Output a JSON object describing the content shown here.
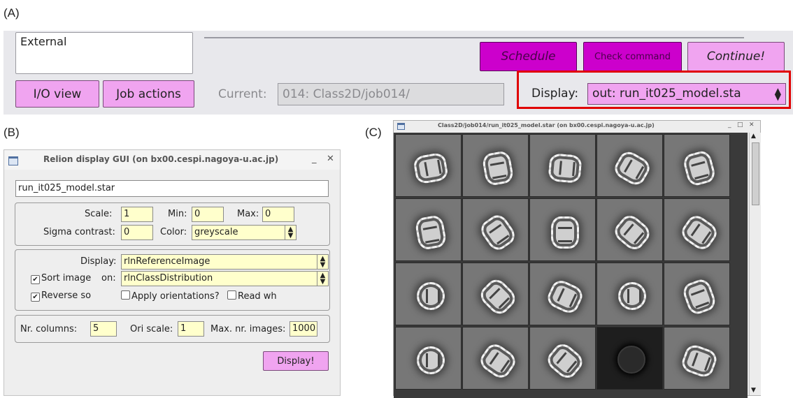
{
  "labels": {
    "a": "(A)",
    "b": "(B)",
    "c": "(C)"
  },
  "panel_a": {
    "job_type_item": "External",
    "buttons": {
      "schedule": "Schedule",
      "check_command": "Check command",
      "continue": "Continue!",
      "io_view": "I/O view",
      "job_actions": "Job actions"
    },
    "current_label": "Current:",
    "current_value": "014: Class2D/job014/",
    "display_label": "Display:",
    "display_value": "out: run_it025_model.sta",
    "colors": {
      "pink": "#f0a4f0",
      "magenta": "#cc00cc",
      "highlight": "#e00000"
    }
  },
  "panel_b": {
    "window_title": "Relion display GUI (on bx00.cespi.nagoya-u.ac.jp)",
    "filename": "run_it025_model.star",
    "scale_label": "Scale:",
    "scale_value": "1",
    "min_label": "Min:",
    "min_value": "0",
    "max_label": "Max:",
    "max_value": "0",
    "sigma_label": "Sigma contrast:",
    "sigma_value": "0",
    "color_label": "Color:",
    "color_value": "greyscale",
    "display_label": "Display:",
    "display_value": "rlnReferenceImage",
    "sort_label": "Sort image",
    "sort_on_label": "on:",
    "sort_value": "rlnClassDistribution",
    "reverse_label": "Reverse so",
    "apply_label": "Apply orientations?",
    "read_label": "Read wh",
    "sort_checked": true,
    "reverse_checked": true,
    "apply_checked": false,
    "read_checked": false,
    "ncol_label": "Nr. columns:",
    "ncol_value": "5",
    "ori_label": "Ori scale:",
    "ori_value": "1",
    "maxn_label": "Max. nr. images:",
    "maxn_value": "1000",
    "display_button": "Display!"
  },
  "panel_c": {
    "window_title": "Class2D/job014/run_it025_model.star (on bx00.cespi.nagoya-u.ac.jp)",
    "rows": 4,
    "columns": 5,
    "dark_cell": [
      3,
      3
    ]
  }
}
